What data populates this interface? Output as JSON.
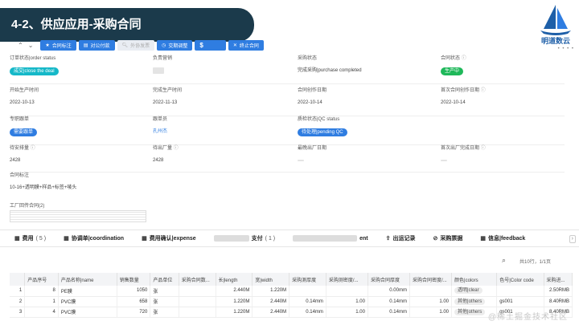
{
  "slide": {
    "title": "4-2、供应应用-采购合同"
  },
  "brand": {
    "text": "明道数云",
    "dots": "• • • •"
  },
  "toolbar": {
    "buttons": [
      {
        "label": "合同标注",
        "icon": "star",
        "style": "primary"
      },
      {
        "label": "对公付款",
        "icon": "card",
        "style": "primary"
      },
      {
        "label": "外协发票",
        "icon": "search",
        "style": "muted"
      },
      {
        "label": "交期调整",
        "icon": "clock",
        "style": "primary"
      },
      {
        "label": "$",
        "icon": "",
        "style": "dollar"
      },
      {
        "label": "终止合同",
        "icon": "x",
        "style": "primary"
      }
    ]
  },
  "form": {
    "rows": [
      [
        {
          "label": "订单状态|order status",
          "info": false,
          "value": "成交|close the deal",
          "kind": "tag-cyan"
        },
        {
          "label": "负责营销",
          "info": false,
          "value": "",
          "kind": "blur"
        },
        {
          "label": "采购状态",
          "info": false,
          "value": "完成采购|purchase completed",
          "kind": "text"
        },
        {
          "label": "合同状态",
          "info": true,
          "value": "生产中",
          "kind": "tag-green"
        }
      ],
      [
        {
          "label": "开始生产时间",
          "info": false,
          "value": "2022-10-13",
          "kind": "text"
        },
        {
          "label": "完成生产时间",
          "info": false,
          "value": "2022-11-13",
          "kind": "text"
        },
        {
          "label": "合同创作日期",
          "info": false,
          "value": "2022-10-14",
          "kind": "text"
        },
        {
          "label": "首次合同创作日期",
          "info": true,
          "value": "2022-10-14",
          "kind": "text"
        }
      ],
      [
        {
          "label": "专职跟单",
          "info": false,
          "value": "需要跟单",
          "kind": "tag-blue"
        },
        {
          "label": "跟单员",
          "info": false,
          "value": "孔州杰",
          "kind": "link"
        },
        {
          "label": "质检状态|QC status",
          "info": false,
          "value": "待处理|pending QC",
          "kind": "tag-blue"
        },
        {
          "label": "",
          "info": false,
          "value": "",
          "kind": "text"
        }
      ],
      [
        {
          "label": "待安排量",
          "info": true,
          "value": "2428",
          "kind": "text"
        },
        {
          "label": "待出厂量",
          "info": true,
          "value": "2428",
          "kind": "text"
        },
        {
          "label": "最晚出厂日期",
          "info": false,
          "value": "",
          "kind": "blurline"
        },
        {
          "label": "首次出厂完成日期",
          "info": true,
          "value": "",
          "kind": "blurline"
        }
      ]
    ],
    "notes_label": "合同标注",
    "notes_value": "10-16+透明膜+样品+标签+唛头",
    "attach_label": "工厂回传合同(2)"
  },
  "tabs": [
    {
      "label": "费用",
      "count": "( 5 )",
      "icon": "doc"
    },
    {
      "label": "协调单|coordination",
      "count": "",
      "icon": "doc"
    },
    {
      "label": "费用确认|expense",
      "count": "",
      "icon": "doc"
    },
    {
      "label": "支付",
      "count": "( 1 )",
      "icon": "blur"
    },
    {
      "label": "ent",
      "count": "",
      "icon": "blur2"
    },
    {
      "label": "出运记录",
      "count": "",
      "icon": "doc"
    },
    {
      "label": "采购票据",
      "count": "",
      "icon": "doc"
    },
    {
      "label": "信息|feedback",
      "count": "",
      "icon": "doc"
    }
  ],
  "table": {
    "pager": "共10行，1/1页",
    "columns": [
      "",
      "产品序号",
      "产品名称|name",
      "销售数量",
      "产品单位",
      "采购合同数...",
      "长|length",
      "宽|width",
      "采购测厚度",
      "采购测密度/...",
      "采购合同厚度",
      "采购合同密度/...",
      "颜色|colors",
      "色号|Color code",
      "采购进..."
    ],
    "rows": [
      [
        "1",
        "8",
        "PE膜",
        "1050",
        "张",
        "",
        "2.440M",
        "1.220M",
        "",
        "",
        "0.00mm",
        "",
        "透明|clear",
        "",
        "2.50RMB"
      ],
      [
        "2",
        "1",
        "PVC膜",
        "658",
        "张",
        "",
        "1.220M",
        "2.440M",
        "0.14mm",
        "1.00",
        "0.14mm",
        "1.00",
        "其他|others",
        "gs001",
        "8.40RMB"
      ],
      [
        "3",
        "4",
        "PVC膜",
        "720",
        "张",
        "",
        "1.220M",
        "2.440M",
        "0.14mm",
        "1.00",
        "0.14mm",
        "1.00",
        "其他|others",
        "gs001",
        "8.40RMB"
      ]
    ]
  },
  "watermark": "@稀土掘金技术社区"
}
